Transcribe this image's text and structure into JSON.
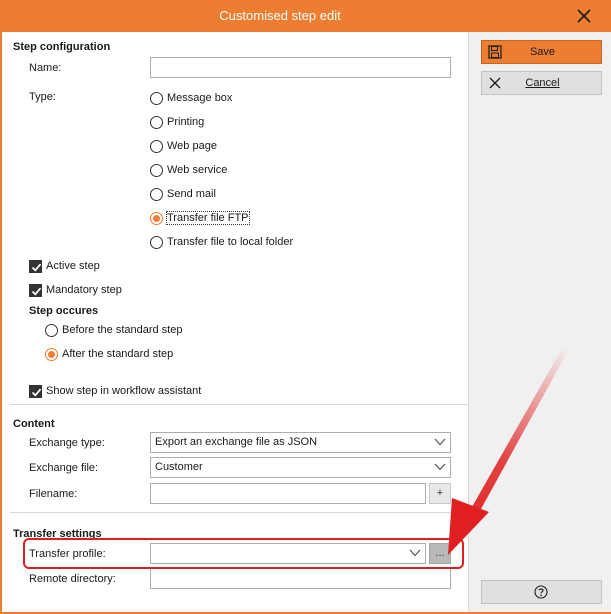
{
  "window": {
    "title": "Customised step edit"
  },
  "step_config": {
    "section_title": "Step configuration",
    "name_label": "Name:",
    "name_value": "",
    "type_label": "Type:",
    "types": [
      {
        "label": "Message box",
        "checked": false
      },
      {
        "label": "Printing",
        "checked": false
      },
      {
        "label": "Web page",
        "checked": false
      },
      {
        "label": "Web service",
        "checked": false
      },
      {
        "label": "Send mail",
        "checked": false
      },
      {
        "label": "Transfer file FTP",
        "checked": true
      },
      {
        "label": "Transfer file to local folder",
        "checked": false
      }
    ],
    "active_step_label": "Active step",
    "active_step_checked": true,
    "mandatory_step_label": "Mandatory step",
    "mandatory_step_checked": true,
    "occurs_title": "Step occures",
    "occurs_options": [
      {
        "label": "Before the standard step",
        "checked": false
      },
      {
        "label": "After the standard step",
        "checked": true
      }
    ],
    "show_assistant_label": "Show step in workflow assistant",
    "show_assistant_checked": true
  },
  "content": {
    "section_title": "Content",
    "exchange_type_label": "Exchange type:",
    "exchange_type_value": "Export an exchange file as JSON",
    "exchange_file_label": "Exchange file:",
    "exchange_file_value": "Customer",
    "filename_label": "Filename:",
    "filename_value": "",
    "filename_button": "+"
  },
  "transfer": {
    "section_title": "Transfer settings",
    "profile_label": "Transfer profile:",
    "profile_value": "",
    "profile_button": "...",
    "remote_dir_label": "Remote directory:",
    "remote_dir_value": ""
  },
  "actions": {
    "save_label": "Save",
    "cancel_label": "Cancel"
  },
  "colors": {
    "accent": "#ed7d31",
    "highlight": "#e02020"
  },
  "icons": {
    "close": "close-icon",
    "save": "floppy-disk-icon",
    "cancel": "x-icon",
    "help": "question-circle-icon",
    "dropdown": "chevron-down-icon"
  }
}
